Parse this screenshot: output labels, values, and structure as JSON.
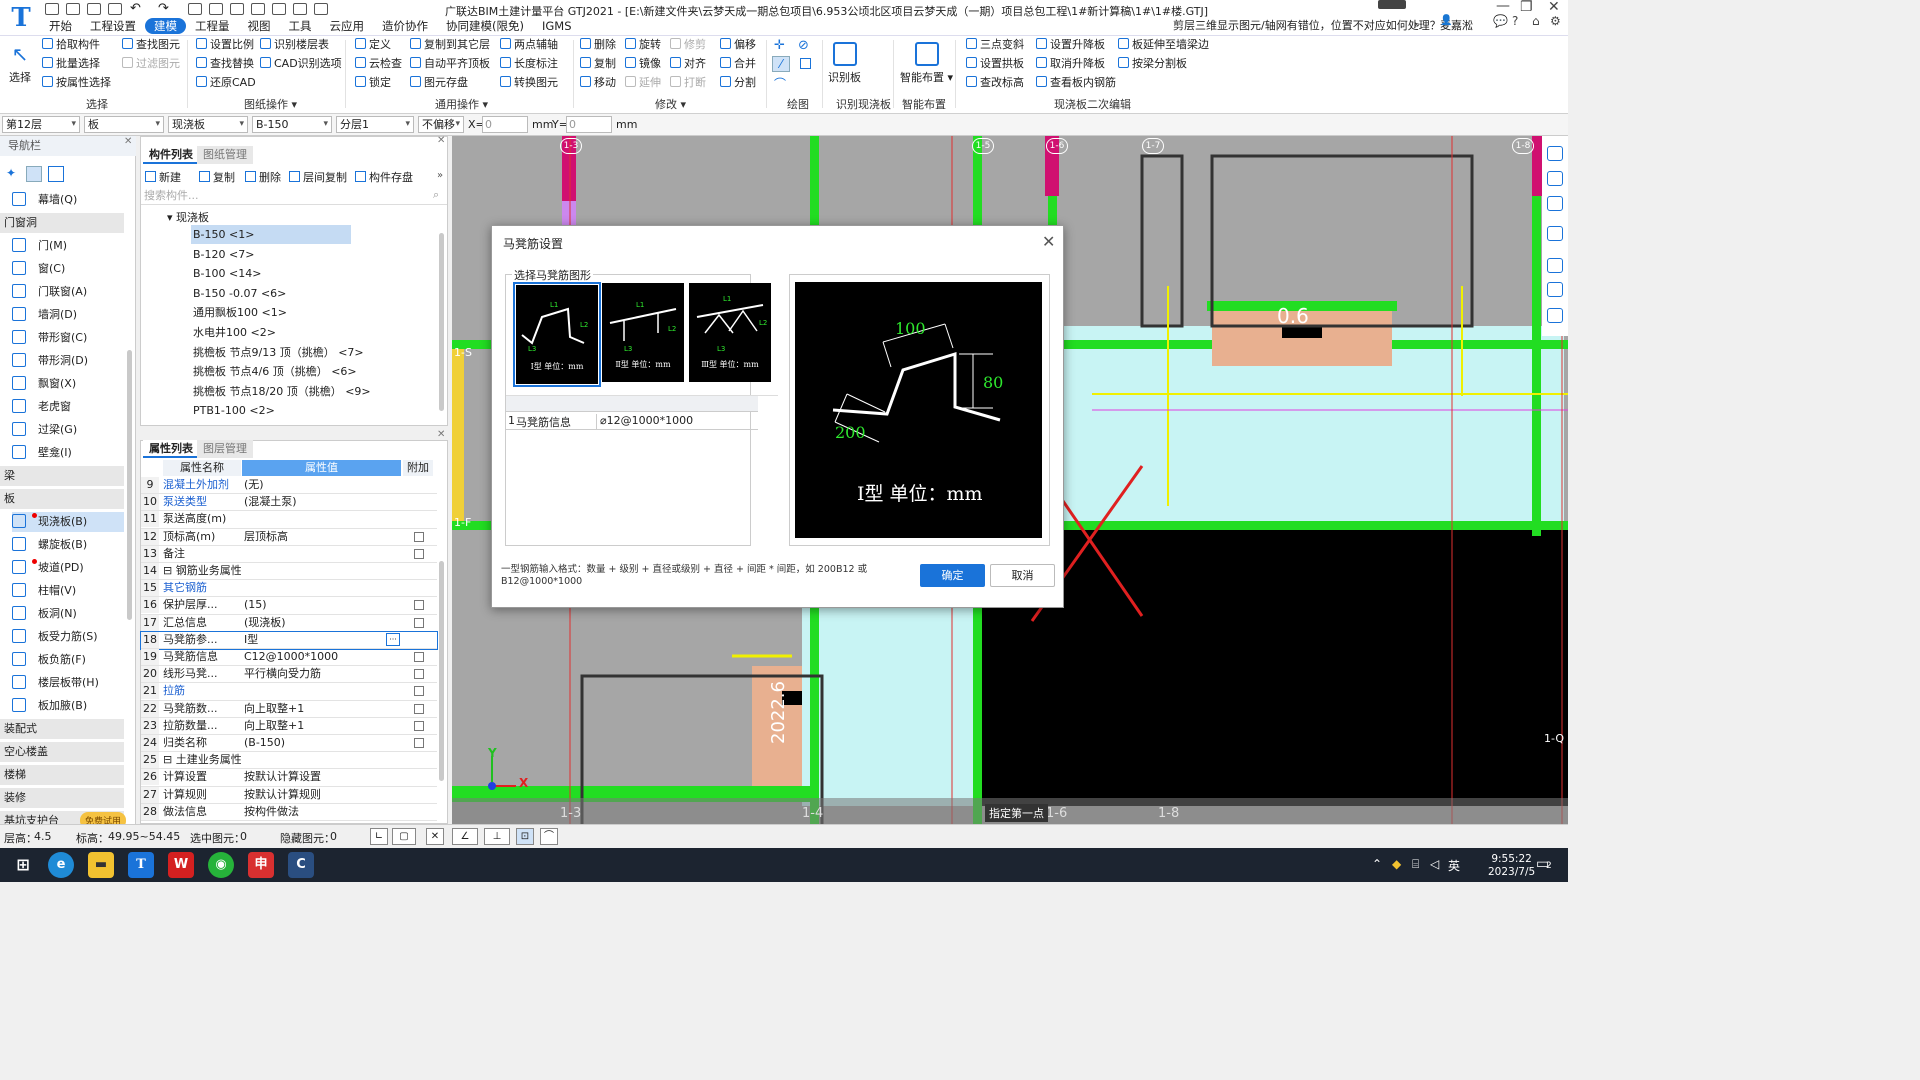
{
  "app": {
    "title": "广联达BIM土建计量平台 GTJ2021 - [E:\\新建文件夹\\云梦天成一期总包项目\\6.953公顷北区项目云梦天成（一期）项目总包工程\\1#新计算稿\\1#\\1#楼.GTJ]",
    "logo": "T"
  },
  "menu": [
    "开始",
    "工程设置",
    "建模",
    "工程量",
    "视图",
    "工具",
    "云应用",
    "造价协作",
    "协同建模(限免)",
    "IGMS"
  ],
  "menu_active": "建模",
  "question": "剪层三维显示图元/轴网有错位，位置不对应如何处理？",
  "user": "麦嘉淞",
  "ribbon": {
    "select": {
      "big": "选择",
      "items": [
        "拾取构件",
        "批量选择",
        "按属性选择"
      ],
      "items2": [
        "查找图元",
        "过滤图元"
      ],
      "group": "选择"
    },
    "drawing": {
      "items": [
        "设置比例",
        "查找替换",
        "还原CAD"
      ],
      "items2": [
        "识别楼层表",
        "CAD识别选项"
      ],
      "group": "图纸操作"
    },
    "common": {
      "items": [
        "定义",
        "云检查",
        "锁定"
      ],
      "items2": [
        "复制到其它层",
        "自动平齐顶板",
        "图元存盘"
      ],
      "items3": [
        "两点辅轴",
        "长度标注",
        "转换图元"
      ],
      "group": "通用操作"
    },
    "modify": {
      "c1": [
        "删除",
        "复制",
        "移动"
      ],
      "c2": [
        "旋转",
        "镜像",
        "延伸"
      ],
      "c3": [
        "修剪",
        "对齐",
        "打断"
      ],
      "c4": [
        "偏移",
        "合并",
        "分割"
      ],
      "group": "修改"
    },
    "draw": {
      "group": "绘图"
    },
    "recog": {
      "big": "识别板",
      "group": "识别现浇板"
    },
    "smart": {
      "big": "智能布置",
      "group": "智能布置"
    },
    "edit2": {
      "c1": [
        "三点变斜",
        "设置拱板",
        "查改标高"
      ],
      "c2": [
        "设置升降板",
        "取消升降板",
        "查看板内钢筋"
      ],
      "c3": [
        "板延伸至墙梁边",
        "按梁分割板"
      ],
      "group": "现浇板二次编辑"
    }
  },
  "selbar": {
    "floor": "第12层",
    "type": "板",
    "sub": "现浇板",
    "comp": "B-150",
    "layer": "分层1",
    "offset": "不偏移",
    "x_label": "X=",
    "x_val": "0",
    "unit1": "mm",
    "y_label": "Y=",
    "y_val": "0",
    "unit2": "mm"
  },
  "nav": {
    "title": "导航栏",
    "items_top": [
      "幕墙(Q)"
    ],
    "cat_door": "门窗洞",
    "door_items": [
      "门(M)",
      "窗(C)",
      "门联窗(A)",
      "墙洞(D)",
      "带形窗(C)",
      "带形洞(D)",
      "飘窗(X)",
      "老虎窗",
      "过梁(G)",
      "壁龛(I)"
    ],
    "cat_beam": "梁",
    "cat_slab": "板",
    "slab_items": [
      "现浇板(B)",
      "螺旋板(B)",
      "坡道(PD)",
      "柱帽(V)",
      "板洞(N)",
      "板受力筋(S)",
      "板负筋(F)",
      "楼层板带(H)",
      "板加腋(B)"
    ],
    "cat_more": [
      "装配式",
      "空心楼盖",
      "楼梯",
      "装修",
      "基坑支护台"
    ],
    "free": "免费试用"
  },
  "comp_panel": {
    "tab1": "构件列表",
    "tab2": "图纸管理",
    "toolbar": [
      "新建",
      "复制",
      "删除",
      "层间复制",
      "构件存盘"
    ],
    "search_placeholder": "搜索构件...",
    "root": "现浇板",
    "items": [
      "B-150 <1>",
      "B-120 <7>",
      "B-100 <14>",
      "B-150 -0.07 <6>",
      "通用飘板100 <1>",
      "水电井100 <2>",
      "挑檐板 节点9/13 顶（挑檐） <7>",
      "挑檐板 节点4/6 顶（挑檐） <6>",
      "挑檐板 节点18/20 顶（挑檐） <9>",
      "PTB1-100 <2>"
    ]
  },
  "prop_panel": {
    "tab1": "属性列表",
    "tab2": "图层管理",
    "head_name": "属性名称",
    "head_val": "属性值",
    "head_extra": "附加",
    "rows": [
      {
        "n": "9",
        "name": "混凝土外加剂",
        "val": "(无)",
        "blue": true,
        "chk": false
      },
      {
        "n": "10",
        "name": "泵送类型",
        "val": "(混凝土泵)",
        "blue": true,
        "chk": false
      },
      {
        "n": "11",
        "name": "泵送高度(m)",
        "val": "",
        "blue": false,
        "chk": false
      },
      {
        "n": "12",
        "name": "顶标高(m)",
        "val": "层顶标高",
        "blue": false,
        "chk": true
      },
      {
        "n": "13",
        "name": "备注",
        "val": "",
        "blue": false,
        "chk": true
      },
      {
        "n": "14",
        "name": "⊟ 钢筋业务属性",
        "val": "",
        "blue": false,
        "chk": false
      },
      {
        "n": "15",
        "name": "  其它钢筋",
        "val": "",
        "blue": true,
        "chk": false
      },
      {
        "n": "16",
        "name": "  保护层厚...",
        "val": "(15)",
        "blue": false,
        "chk": true
      },
      {
        "n": "17",
        "name": "  汇总信息",
        "val": "(现浇板)",
        "blue": false,
        "chk": true
      },
      {
        "n": "18",
        "name": "  马凳筋参...",
        "val": "Ⅰ型",
        "blue": false,
        "chk": false
      },
      {
        "n": "19",
        "name": "  马凳筋信息",
        "val": "C12@1000*1000",
        "blue": false,
        "chk": true
      },
      {
        "n": "20",
        "name": "  线形马凳...",
        "val": "平行横向受力筋",
        "blue": false,
        "chk": true
      },
      {
        "n": "21",
        "name": "  拉筋",
        "val": "",
        "blue": true,
        "chk": true
      },
      {
        "n": "22",
        "name": "  马凳筋数...",
        "val": "向上取整+1",
        "blue": false,
        "chk": true
      },
      {
        "n": "23",
        "name": "  拉筋数量...",
        "val": "向上取整+1",
        "blue": false,
        "chk": true
      },
      {
        "n": "24",
        "name": "  归类名称",
        "val": "(B-150)",
        "blue": false,
        "chk": true
      },
      {
        "n": "25",
        "name": "⊟ 土建业务属性",
        "val": "",
        "blue": false,
        "chk": false
      },
      {
        "n": "26",
        "name": "  计算设置",
        "val": "按默认计算设置",
        "blue": false,
        "chk": false
      },
      {
        "n": "27",
        "name": "  计算规则",
        "val": "按默认计算规则",
        "blue": false,
        "chk": false
      },
      {
        "n": "28",
        "name": "  做法信息",
        "val": "按构件做法",
        "blue": false,
        "chk": false
      }
    ]
  },
  "canvas": {
    "axis_top": [
      "1-3",
      "1-5",
      "1-6",
      "1-7",
      "1-8"
    ],
    "axis_bottom": [
      "1-3",
      "1-4",
      "1-6",
      "1-8"
    ],
    "axis_side": [
      "1-S",
      "1-F",
      "1-Q"
    ],
    "label_06": "0.6",
    "label_vert": "2022.6",
    "hint": "指定第一点",
    "x": "X",
    "y": "Y"
  },
  "dialog": {
    "title": "马凳筋设置",
    "group_label": "选择马凳筋图形",
    "thumbs": [
      {
        "cap": "Ⅰ型  单位：mm"
      },
      {
        "cap": "Ⅱ型  单位：mm"
      },
      {
        "cap": "Ⅲ型  单位：mm"
      }
    ],
    "thumb_labels": {
      "l1": "L1",
      "l2": "L2",
      "l3": "L3"
    },
    "info_row_no": "1",
    "info_name": "马凳筋信息",
    "info_val": "⌀12@1000*1000",
    "preview": {
      "dim_top": "100",
      "dim_right": "80",
      "dim_left": "200",
      "caption": "Ⅰ型  单位：mm"
    },
    "hint": "一型钢筋输入格式：数量 + 级别 + 直径或级别 + 直径 + 间距 * 间距，如 200B12 或 B12@1000*1000",
    "ok": "确定",
    "cancel": "取消"
  },
  "status": {
    "floor_h_label": "层高：",
    "floor_h": "4.5",
    "elev_label": "标高：",
    "elev": "49.95~54.45",
    "sel_label": "选中图元：",
    "sel": "0",
    "hidden_label": "隐藏图元：",
    "hidden": "0"
  },
  "taskbar": {
    "time": "9:55:22",
    "date": "2023/7/5",
    "ime": "英",
    "notif": "2"
  },
  "colors": {
    "accent": "#1a73d9",
    "wall_green": "#22dd22",
    "magenta": "#d01070",
    "slab_cyan": "#c8f4f4"
  }
}
